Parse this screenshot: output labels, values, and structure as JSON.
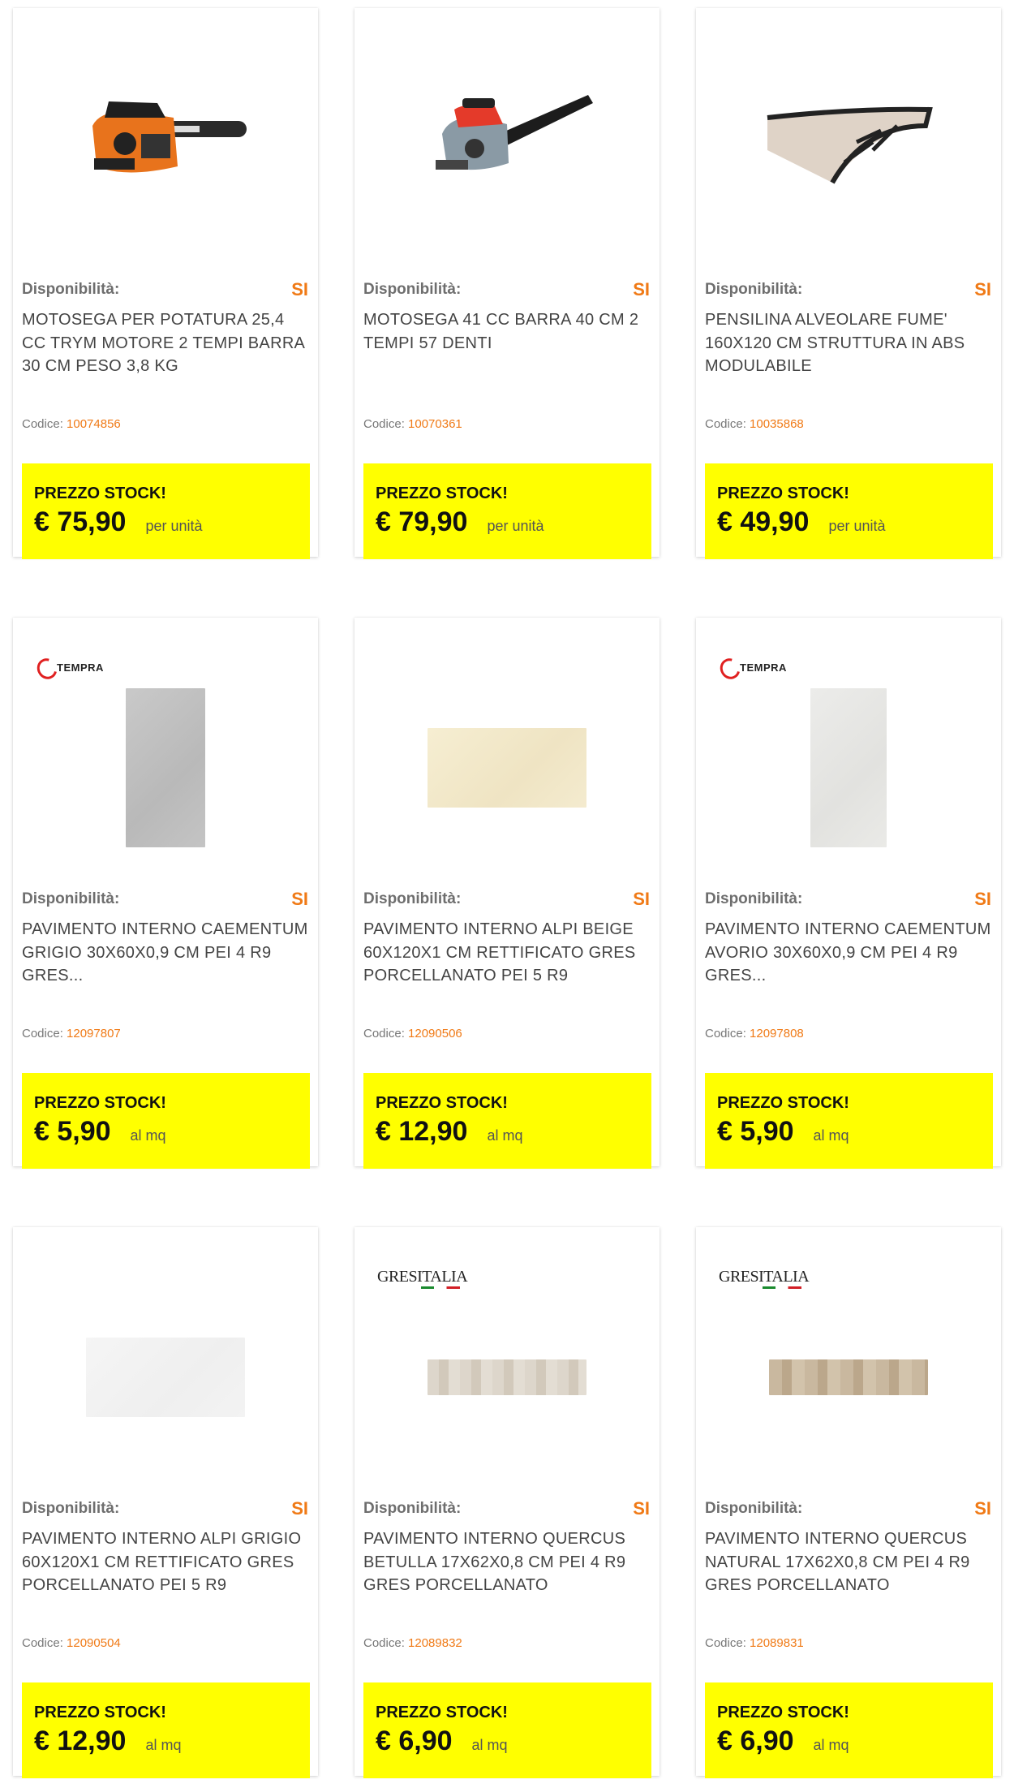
{
  "availability_label": "Disponibilità:",
  "availability_value": "SI",
  "code_label": "Codice:",
  "stock_label": "PREZZO STOCK!",
  "colors": {
    "accent_yellow": "#ffff00",
    "accent_orange": "#f07a16"
  },
  "products": [
    {
      "title": "MOTOSEGA PER POTATURA 25,4 CC TRYM MOTORE 2 TEMPI BARRA 30 CM PESO 3,8 KG",
      "code": "10074856",
      "price": "€ 75,90",
      "unit": "per unità",
      "brand": "",
      "icon": "chainsaw-orange-icon"
    },
    {
      "title": "MOTOSEGA 41 CC BARRA 40 CM 2 TEMPI 57 DENTI",
      "code": "10070361",
      "price": "€ 79,90",
      "unit": "per unità",
      "brand": "",
      "icon": "chainsaw-red-icon"
    },
    {
      "title": "PENSILINA ALVEOLARE FUME' 160X120 CM STRUTTURA IN ABS MODULABILE",
      "code": "10035868",
      "price": "€ 49,90",
      "unit": "per unità",
      "brand": "",
      "icon": "canopy-icon"
    },
    {
      "title": "PAVIMENTO INTERNO CAEMENTUM GRIGIO 30X60X0,9 CM PEI 4 R9 GRES...",
      "code": "12097807",
      "price": "€ 5,90",
      "unit": "al mq",
      "brand": "TEMPRA",
      "icon": "tile-grey-icon"
    },
    {
      "title": "PAVIMENTO INTERNO ALPI BEIGE 60X120X1 CM RETTIFICATO GRES PORCELLANATO PEI 5 R9",
      "code": "12090506",
      "price": "€ 12,90",
      "unit": "al mq",
      "brand": "",
      "icon": "tile-beige-icon"
    },
    {
      "title": "PAVIMENTO INTERNO CAEMENTUM AVORIO 30X60X0,9 CM PEI 4 R9 GRES...",
      "code": "12097808",
      "price": "€ 5,90",
      "unit": "al mq",
      "brand": "TEMPRA",
      "icon": "tile-ivory-icon"
    },
    {
      "title": "PAVIMENTO INTERNO ALPI GRIGIO 60X120X1 CM RETTIFICATO GRES PORCELLANATO PEI 5 R9",
      "code": "12090504",
      "price": "€ 12,90",
      "unit": "al mq",
      "brand": "",
      "icon": "tile-lightgrey-icon"
    },
    {
      "title": "PAVIMENTO INTERNO QUERCUS BETULLA 17X62X0,8 CM PEI 4 R9 GRES PORCELLANATO",
      "code": "12089832",
      "price": "€ 6,90",
      "unit": "al mq",
      "brand": "GRESITALIA",
      "icon": "tile-wood-light-icon"
    },
    {
      "title": "PAVIMENTO INTERNO QUERCUS NATURAL 17X62X0,8 CM PEI 4 R9 GRES PORCELLANATO",
      "code": "12089831",
      "price": "€ 6,90",
      "unit": "al mq",
      "brand": "GRESITALIA",
      "icon": "tile-wood-natural-icon"
    }
  ]
}
